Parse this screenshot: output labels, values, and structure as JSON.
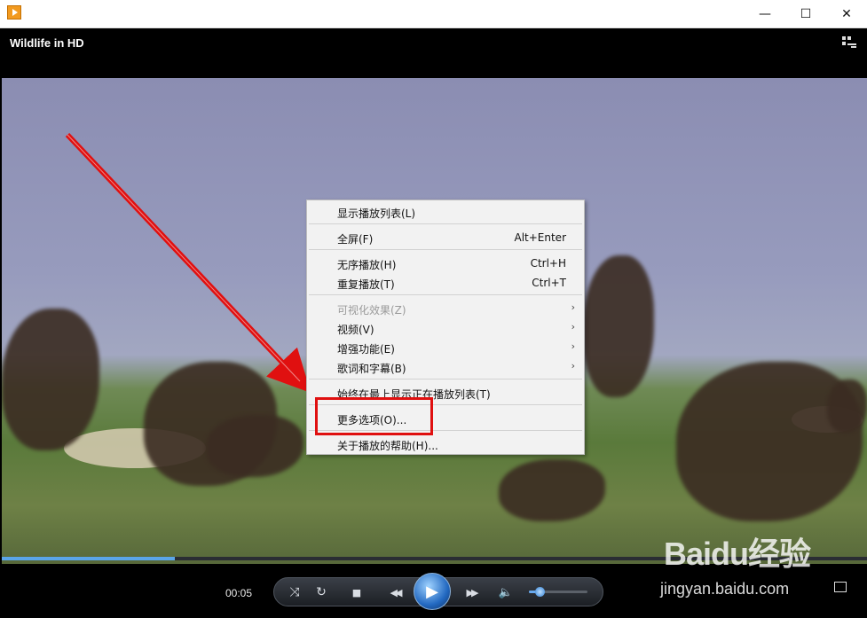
{
  "window": {
    "minimize": "—",
    "maximize": "☐",
    "close": "✕"
  },
  "header": {
    "title": "Wildlife in HD",
    "switch_icon": "switch-to-library-icon"
  },
  "context_menu": {
    "items": [
      {
        "label": "显示播放列表(L)",
        "shortcut": "",
        "submenu": ""
      },
      {
        "label": "全屏(F)",
        "shortcut": "Alt+Enter",
        "submenu": ""
      },
      {
        "label": "无序播放(H)",
        "shortcut": "Ctrl+H",
        "submenu": ""
      },
      {
        "label": "重复播放(T)",
        "shortcut": "Ctrl+T",
        "submenu": ""
      },
      {
        "label": "可视化效果(Z)",
        "shortcut": "",
        "submenu": "›",
        "disabled": true
      },
      {
        "label": "视频(V)",
        "shortcut": "",
        "submenu": "›"
      },
      {
        "label": "增强功能(E)",
        "shortcut": "",
        "submenu": "›"
      },
      {
        "label": "歌词和字幕(B)",
        "shortcut": "",
        "submenu": "›"
      },
      {
        "label": "始终在最上显示正在播放列表(T)",
        "shortcut": "",
        "submenu": ""
      },
      {
        "label": "更多选项(O)...",
        "shortcut": "",
        "submenu": ""
      },
      {
        "label": "关于播放的帮助(H)...",
        "shortcut": "",
        "submenu": ""
      }
    ]
  },
  "playback": {
    "time": "00:05",
    "progress": 0.2,
    "volume": 0.18
  },
  "controls": {
    "shuffle": "⤨",
    "repeat": "↻",
    "stop": "■",
    "prev": "◀◀",
    "play": "▶",
    "next": "▶▶",
    "mute": "🔈"
  },
  "watermark": {
    "brand": "Baidu经验",
    "url": "jingyan.baidu.com"
  },
  "colors": {
    "accent": "#2369c1",
    "highlight_box": "#e01010",
    "arrow": "#e01010"
  }
}
